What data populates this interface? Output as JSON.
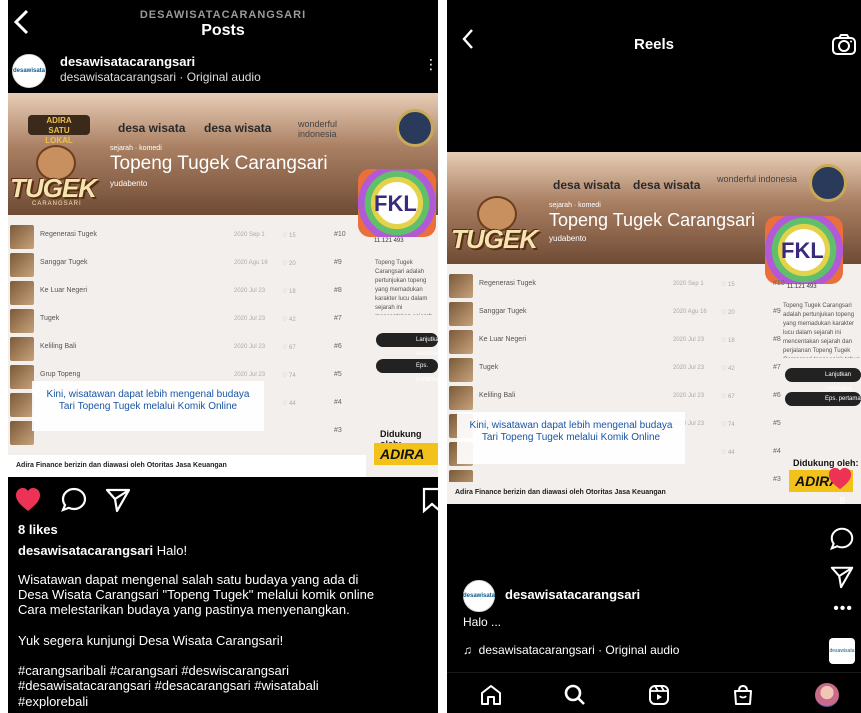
{
  "left": {
    "header": {
      "subtitle": "DESAWISATACARANGSARI",
      "title": "Posts",
      "back": "<"
    },
    "post_header": {
      "avatar_text": "desawisata",
      "username": "desawisatacarangsari",
      "audio": "desawisatacarangsari · Original audio"
    },
    "post_image": {
      "brand_adira": "ADIRA\nSATU\nLOKAL",
      "brand_dw1": "desa wisata",
      "brand_dw2": "desa wisata",
      "brand_wi": "wonderful\nindonesia",
      "tugek_word": "TUGEK",
      "tugek_sub": "CARANGSARI",
      "tags": "sejarah · komedi",
      "title": "Topeng Tugek Carangsari",
      "author": "yudabento",
      "fkl": "FKL",
      "fkl_stats": "11.121   493",
      "episodes": [
        {
          "name": "Regenerasi Tugek",
          "date": "2020 Sep 1",
          "likes": "♡ 15",
          "num": "#10"
        },
        {
          "name": "Sanggar Tugek",
          "date": "2020 Agu 16",
          "likes": "♡ 20",
          "num": "#9"
        },
        {
          "name": "Ke Luar Negeri",
          "date": "2020 Jul 23",
          "likes": "♡ 18",
          "num": "#8"
        },
        {
          "name": "Tugek",
          "date": "2020 Jul 23",
          "likes": "♡ 42",
          "num": "#7"
        },
        {
          "name": "Keliling Bali",
          "date": "2020 Jul 23",
          "likes": "♡ 67",
          "num": "#6"
        },
        {
          "name": "Grup Topeng",
          "date": "2020 Jul 23",
          "likes": "♡ 74",
          "num": "#5"
        },
        {
          "name": "",
          "date": "",
          "likes": "♡ 44",
          "num": "#4"
        },
        {
          "name": "",
          "date": "",
          "likes": "",
          "num": "#3"
        }
      ],
      "side_text": "Topeng Tugek Carangsari adalah pertunjukan topeng yang memadukan karakter lucu dalam sejarah ini mencentakan sejarah dan perjalanan Topeng Tugek Carangsari tenar sejak tahun 1970-an",
      "btn_continue": "Lanjutkan membaca",
      "btn_episode": "Eps. pertama",
      "supported_by": "Didukung oleh:",
      "adira_badge": "ADIRA",
      "caption_card": "Kini, wisatawan dapat lebih mengenal budaya Tari Topeng Tugek melalui Komik Online",
      "footer": "Adira Finance berizin dan diawasi oleh Otoritas Jasa Keuangan"
    },
    "likes": "8 likes",
    "caption": {
      "user": "desawisatacarangsari",
      "first": "Halo!",
      "lines": [
        "Wisatawan dapat mengenal salah satu budaya yang ada di",
        "Desa Wisata Carangsari \"Topeng Tugek\" melalui komik online",
        "Cara melestarikan budaya yang pastinya menyenangkan.",
        "",
        "Yuk segera kunjungi Desa Wisata Carangsari!",
        "",
        "#carangsaribali #carangsari #deswiscarangsari",
        "#desawisatacarangsari #desacarangsari #wisatabali",
        "#explorebali"
      ]
    },
    "colors": {
      "heart": "#ed3355"
    }
  },
  "right": {
    "header": {
      "title": "Reels",
      "back": "<"
    },
    "reel_image": {
      "brand_dw1": "desa wisata",
      "brand_dw2": "desa wisata",
      "brand_wi": "wonderful\nindonesia",
      "tags": "sejarah · komedi",
      "title": "Topeng Tugek Carangsari",
      "author": "yudabento",
      "tugek_word": "TUGEK",
      "fkl": "FKL",
      "fkl_stats": "11.121   493",
      "episodes": [
        {
          "name": "Regenerasi Tugek",
          "date": "2020 Sep 1",
          "likes": "♡ 15",
          "num": "#10"
        },
        {
          "name": "Sanggar Tugek",
          "date": "2020 Agu 16",
          "likes": "♡ 20",
          "num": "#9"
        },
        {
          "name": "Ke Luar Negeri",
          "date": "2020 Jul 23",
          "likes": "♡ 18",
          "num": "#8"
        },
        {
          "name": "Tugek",
          "date": "2020 Jul 23",
          "likes": "♡ 42",
          "num": "#7"
        },
        {
          "name": "Keliling Bali",
          "date": "2020 Jul 23",
          "likes": "♡ 67",
          "num": "#6"
        },
        {
          "name": "Grup Topeng",
          "date": "2020 Jul 23",
          "likes": "♡ 74",
          "num": "#5"
        },
        {
          "name": "",
          "date": "",
          "likes": "♡ 44",
          "num": "#4"
        },
        {
          "name": "",
          "date": "",
          "likes": "",
          "num": "#3"
        }
      ],
      "side_text": "Topeng Tugek Carangsari adalah pertunjukan topeng yang memadukan karakter lucu dalam sejarah ini mencentakan sejarah dan perjalanan Topeng Tugek Carangsari tenar sejak tahun 1970-an",
      "btn_continue": "Lanjutkan membaca",
      "btn_episode": "Eps. pertama",
      "supported_by": "Didukung oleh:",
      "adira_badge": "ADIRA",
      "caption_card": "Kini, wisatawan dapat lebih mengenal budaya Tari Topeng Tugek melalui Komik Online",
      "footer": "Adira Finance berizin dan diawasi oleh Otoritas Jasa Keuangan"
    },
    "like_count": "8",
    "user": {
      "avatar_text": "desawisata",
      "username": "desawisatacarangsari"
    },
    "caption": "Halo ...",
    "audio": "desawisatacarangsari · Original audio",
    "audio_thumb": "desawisata"
  }
}
